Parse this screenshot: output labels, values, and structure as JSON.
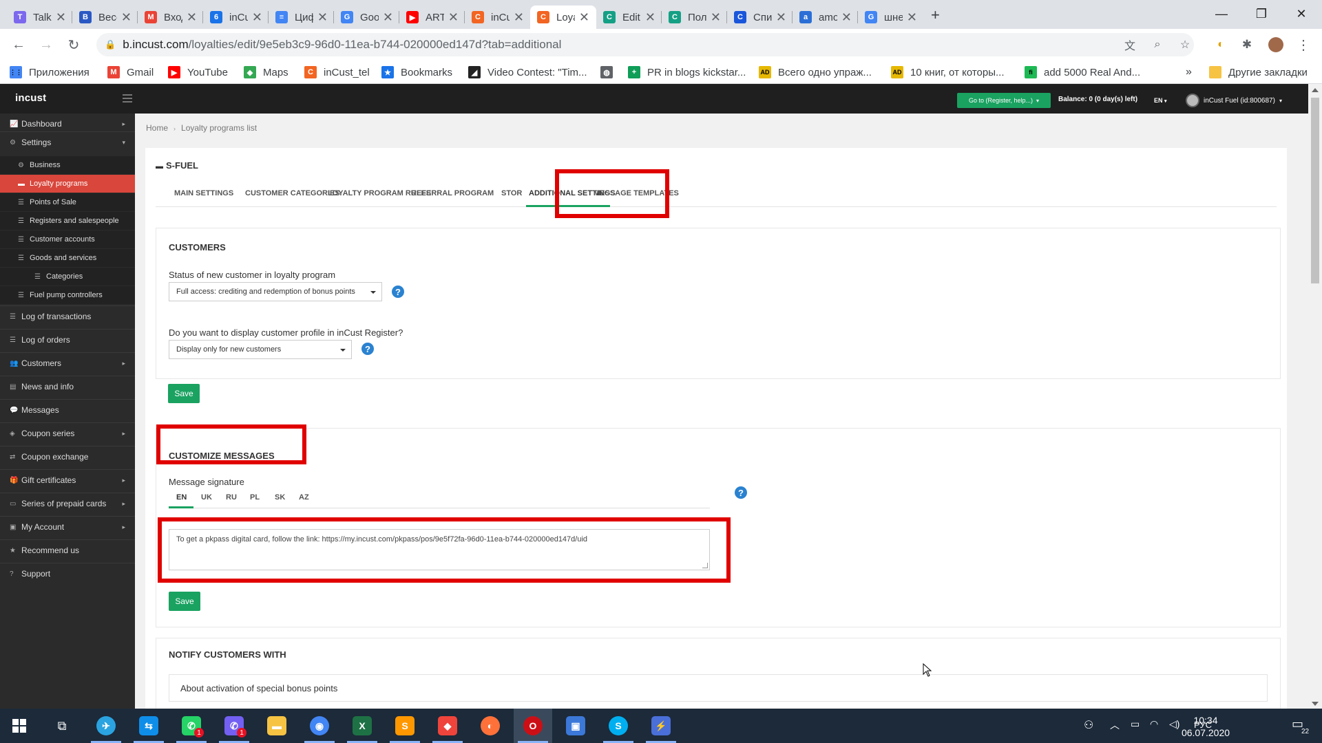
{
  "browser": {
    "tabs": [
      {
        "title": "Talk-M",
        "fav_text": "T",
        "fav_color": "#7b68ee",
        "active": false
      },
      {
        "title": "Весом",
        "fav_text": "B",
        "fav_color": "#2b59c3",
        "active": false
      },
      {
        "title": "Входя",
        "fav_text": "M",
        "fav_color": "#ea4335",
        "active": false
      },
      {
        "title": "inCus",
        "fav_text": "6",
        "fav_color": "#1a73e8",
        "active": false
      },
      {
        "title": "Цифр",
        "fav_text": "≡",
        "fav_color": "#4285f4",
        "active": false
      },
      {
        "title": "Goog",
        "fav_text": "G",
        "fav_color": "#4285f4",
        "active": false
      },
      {
        "title": "ARTIK",
        "fav_text": "▶",
        "fav_color": "#ff0000",
        "active": false
      },
      {
        "title": "inCus",
        "fav_text": "C",
        "fav_color": "#f26522",
        "active": false
      },
      {
        "title": "Loyal",
        "fav_text": "C",
        "fav_color": "#f26522",
        "active": true
      },
      {
        "title": "Edit F",
        "fav_text": "C",
        "fav_color": "#14a085",
        "active": false
      },
      {
        "title": "Полу",
        "fav_text": "C",
        "fav_color": "#14a085",
        "active": false
      },
      {
        "title": "Спис",
        "fav_text": "C",
        "fav_color": "#1a56db",
        "active": false
      },
      {
        "title": "amoC",
        "fav_text": "a",
        "fav_color": "#2b6fd6",
        "active": false
      },
      {
        "title": "шнек",
        "fav_text": "G",
        "fav_color": "#4285f4",
        "active": false
      }
    ],
    "new_tab": "+",
    "url_host": "b.incust.com",
    "url_path": "/loyalties/edit/9e5eb3c9-96d0-11ea-b744-020000ed147d?tab=additional",
    "bookmarks": [
      {
        "label": "Приложения",
        "icon_text": "⋮⋮",
        "icon_color": "#4285f4"
      },
      {
        "label": "Gmail",
        "icon_text": "M",
        "icon_color": "#ea4335"
      },
      {
        "label": "YouTube",
        "icon_text": "▶",
        "icon_color": "#ff0000"
      },
      {
        "label": "Maps",
        "icon_text": "◆",
        "icon_color": "#34a853"
      },
      {
        "label": "inCust_tel",
        "icon_text": "C",
        "icon_color": "#f26522"
      },
      {
        "label": "Bookmarks",
        "icon_text": "★",
        "icon_color": "#1a73e8"
      },
      {
        "label": "Video Contest: \"Tim...",
        "icon_text": "◢",
        "icon_color": "#222222"
      },
      {
        "label": "",
        "icon_text": "◍",
        "icon_color": "#5f6368"
      },
      {
        "label": "PR in blogs kickstar...",
        "icon_text": "+",
        "icon_color": "#0f9d58"
      },
      {
        "label": "Всего одно упраж...",
        "icon_text": "AD",
        "icon_color": "#e6b800"
      },
      {
        "label": "10 книг, от которы...",
        "icon_text": "AD",
        "icon_color": "#e6b800"
      },
      {
        "label": "add 5000 Real And...",
        "icon_text": "fi",
        "icon_color": "#1db954"
      }
    ],
    "bookmarks_more": "»",
    "other_bookmarks": "Другие закладки"
  },
  "app": {
    "logo": "incust",
    "goto_button": "Go to (Register, help...)",
    "balance": "Balance: 0 (0 day(s) left)",
    "language": "EN",
    "account": "inCust Fuel (id:800687)"
  },
  "sidebar": {
    "items": [
      {
        "label": "Dashboard",
        "icon": "chart-icon",
        "glyph": "📈",
        "level": 0,
        "chevron": true,
        "active": false
      },
      {
        "label": "Settings",
        "icon": "gear-icon",
        "glyph": "⚙",
        "level": 0,
        "chevron": true,
        "active": false
      },
      {
        "label": "Business",
        "icon": "gear-icon",
        "glyph": "⚙",
        "level": 1,
        "chevron": false,
        "active": false
      },
      {
        "label": "Loyalty programs",
        "icon": "briefcase-icon",
        "glyph": "▬",
        "level": 1,
        "chevron": false,
        "active": true
      },
      {
        "label": "Points of Sale",
        "icon": "list-icon",
        "glyph": "☰",
        "level": 1,
        "chevron": false,
        "active": false
      },
      {
        "label": "Registers and salespeople",
        "icon": "list-icon",
        "glyph": "☰",
        "level": 1,
        "chevron": false,
        "active": false
      },
      {
        "label": "Customer accounts",
        "icon": "list-icon",
        "glyph": "☰",
        "level": 1,
        "chevron": false,
        "active": false
      },
      {
        "label": "Goods and services",
        "icon": "list-icon",
        "glyph": "☰",
        "level": 1,
        "chevron": false,
        "active": false
      },
      {
        "label": "Categories",
        "icon": "list-icon",
        "glyph": "☰",
        "level": 2,
        "chevron": false,
        "active": false
      },
      {
        "label": "Fuel pump controllers",
        "icon": "list-icon",
        "glyph": "☰",
        "level": 1,
        "chevron": false,
        "active": false
      },
      {
        "label": "Log of transactions",
        "icon": "list-icon",
        "glyph": "☰",
        "level": 0,
        "chevron": false,
        "active": false
      },
      {
        "label": "Log of orders",
        "icon": "list-icon",
        "glyph": "☰",
        "level": 0,
        "chevron": false,
        "active": false
      },
      {
        "label": "Customers",
        "icon": "users-icon",
        "glyph": "👥",
        "level": 0,
        "chevron": true,
        "active": false
      },
      {
        "label": "News and info",
        "icon": "news-icon",
        "glyph": "▤",
        "level": 0,
        "chevron": false,
        "active": false
      },
      {
        "label": "Messages",
        "icon": "comment-icon",
        "glyph": "💬",
        "level": 0,
        "chevron": false,
        "active": false
      },
      {
        "label": "Coupon series",
        "icon": "tag-icon",
        "glyph": "◈",
        "level": 0,
        "chevron": true,
        "active": false
      },
      {
        "label": "Coupon exchange",
        "icon": "exchange-icon",
        "glyph": "⇄",
        "level": 0,
        "chevron": false,
        "active": false
      },
      {
        "label": "Gift certificates",
        "icon": "gift-icon",
        "glyph": "🎁",
        "level": 0,
        "chevron": true,
        "active": false
      },
      {
        "label": "Series of prepaid cards",
        "icon": "card-icon",
        "glyph": "▭",
        "level": 0,
        "chevron": true,
        "active": false
      },
      {
        "label": "My Account",
        "icon": "account-icon",
        "glyph": "▣",
        "level": 0,
        "chevron": true,
        "active": false
      },
      {
        "label": "Recommend us",
        "icon": "star-icon",
        "glyph": "★",
        "level": 0,
        "chevron": false,
        "active": false
      },
      {
        "label": "Support",
        "icon": "question-icon",
        "glyph": "?",
        "level": 0,
        "chevron": false,
        "active": false
      }
    ]
  },
  "breadcrumb": {
    "home": "Home",
    "current": "Loyalty programs list"
  },
  "program": {
    "title": "S-FUEL"
  },
  "tabs": [
    {
      "label": "MAIN SETTINGS",
      "active": false
    },
    {
      "label": "CUSTOMER CATEGORIES",
      "active": false
    },
    {
      "label": "LOYALTY PROGRAM RULES",
      "active": false
    },
    {
      "label": "REFERRAL PROGRAM",
      "active": false
    },
    {
      "label": "STOR",
      "active": false
    },
    {
      "label": "ADDITIONAL SETTINGS",
      "active": true
    },
    {
      "label": "MESSAGE TEMPLATES",
      "active": false
    }
  ],
  "customers": {
    "title": "CUSTOMERS",
    "status_label": "Status of new customer in loyalty program",
    "status_value": "Full access: crediting and redemption of bonus points",
    "display_label": "Do you want to display customer profile in inCust Register?",
    "display_value": "Display only for new customers",
    "save": "Save",
    "help": "?"
  },
  "customize": {
    "title": "CUSTOMIZE MESSAGES",
    "signature_label": "Message signature",
    "langs": [
      "EN",
      "UK",
      "RU",
      "PL",
      "SK",
      "AZ"
    ],
    "signature_text": "To get a pkpass digital card, follow the link: https://my.incust.com/pkpass/pos/9e5f72fa-96d0-11ea-b744-020000ed147d/uid",
    "save": "Save",
    "help": "?"
  },
  "notify": {
    "title": "NOTIFY CUSTOMERS WITH",
    "first_item": "About activation of special bonus points"
  },
  "taskbar": {
    "apps": [
      {
        "name": "telegram",
        "glyph": "✈",
        "color": "#2aa3e0",
        "badge": ""
      },
      {
        "name": "teamviewer",
        "glyph": "⇆",
        "color": "#0e8ee9",
        "badge": ""
      },
      {
        "name": "whatsapp",
        "glyph": "✆",
        "color": "#25d366",
        "badge": "1"
      },
      {
        "name": "viber",
        "glyph": "✆",
        "color": "#7360f2",
        "badge": "1"
      },
      {
        "name": "explorer",
        "glyph": "▬",
        "color": "#f6c343",
        "badge": ""
      },
      {
        "name": "chrome",
        "glyph": "◉",
        "color": "#4285f4",
        "badge": ""
      },
      {
        "name": "excel",
        "glyph": "X",
        "color": "#1e7145",
        "badge": ""
      },
      {
        "name": "sublime",
        "glyph": "S",
        "color": "#ff9800",
        "badge": ""
      },
      {
        "name": "anydesk",
        "glyph": "◆",
        "color": "#ef443b",
        "badge": ""
      },
      {
        "name": "firefox",
        "glyph": "◐",
        "color": "#ff7139",
        "badge": ""
      },
      {
        "name": "opera",
        "glyph": "O",
        "color": "#cc0f16",
        "badge": ""
      },
      {
        "name": "remote-desktop",
        "glyph": "▣",
        "color": "#3b78d8",
        "badge": ""
      },
      {
        "name": "skype",
        "glyph": "S",
        "color": "#00aff0",
        "badge": ""
      },
      {
        "name": "bolt",
        "glyph": "⚡",
        "color": "#4a6fd8",
        "badge": ""
      }
    ],
    "keyboard": "РУС",
    "time": "10:34",
    "date": "06.07.2020",
    "notifications": "22"
  }
}
